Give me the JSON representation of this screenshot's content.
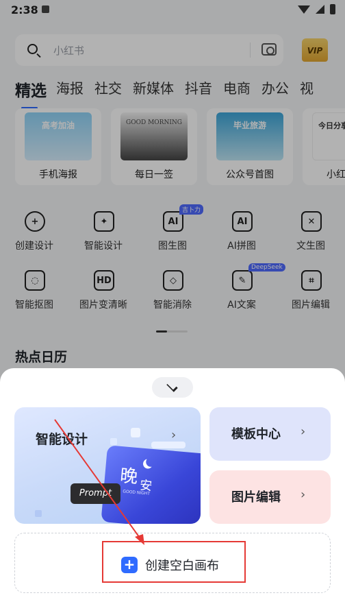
{
  "status_bar": {
    "time": "2:38"
  },
  "search": {
    "placeholder": "小红书"
  },
  "vip": {
    "label": "VIP"
  },
  "tabs": [
    "精选",
    "海报",
    "社交",
    "新媒体",
    "抖音",
    "电商",
    "办公",
    "视"
  ],
  "templates": [
    {
      "thumb": "高考加油",
      "label": "手机海报"
    },
    {
      "thumb": "GOOD MORNING",
      "label": "每日一签"
    },
    {
      "thumb": "毕业旅游",
      "label": "公众号首图"
    },
    {
      "thumb": "今日分享",
      "label": "小红书配"
    }
  ],
  "tools": [
    {
      "label": "创建设计",
      "icon": "plus-circle-icon",
      "glyph": "+"
    },
    {
      "label": "智能设计",
      "icon": "magic-wand-icon",
      "glyph": "✦"
    },
    {
      "label": "图生图",
      "icon": "image-ai-icon",
      "glyph": "AI",
      "badge": "吉卜力"
    },
    {
      "label": "AI拼图",
      "icon": "collage-ai-icon",
      "glyph": "AI"
    },
    {
      "label": "文生图",
      "icon": "text-to-image-icon",
      "glyph": "✕"
    },
    {
      "label": "智能抠图",
      "icon": "cutout-icon",
      "glyph": "◌"
    },
    {
      "label": "图片变清晰",
      "icon": "hd-icon",
      "glyph": "HD"
    },
    {
      "label": "智能消除",
      "icon": "eraser-icon",
      "glyph": "◇"
    },
    {
      "label": "AI文案",
      "icon": "pen-icon",
      "glyph": "✎",
      "badge": "DeepSeek"
    },
    {
      "label": "图片编辑",
      "icon": "image-edit-icon",
      "glyph": "⌗"
    }
  ],
  "hot_section": {
    "title": "热点日历"
  },
  "sheet": {
    "smart_design": {
      "title": "智能设计",
      "card_big": "晚",
      "card_small": "安",
      "card_sub": "GOOD NIGHT"
    },
    "prompt_chip": "Prompt",
    "template_center": "模板中心",
    "image_edit": "图片编辑",
    "blank_canvas": {
      "icon": "+",
      "label": "创建空白画布"
    }
  },
  "colors": {
    "accent": "#2f6bff",
    "annotation": "#e53935"
  }
}
